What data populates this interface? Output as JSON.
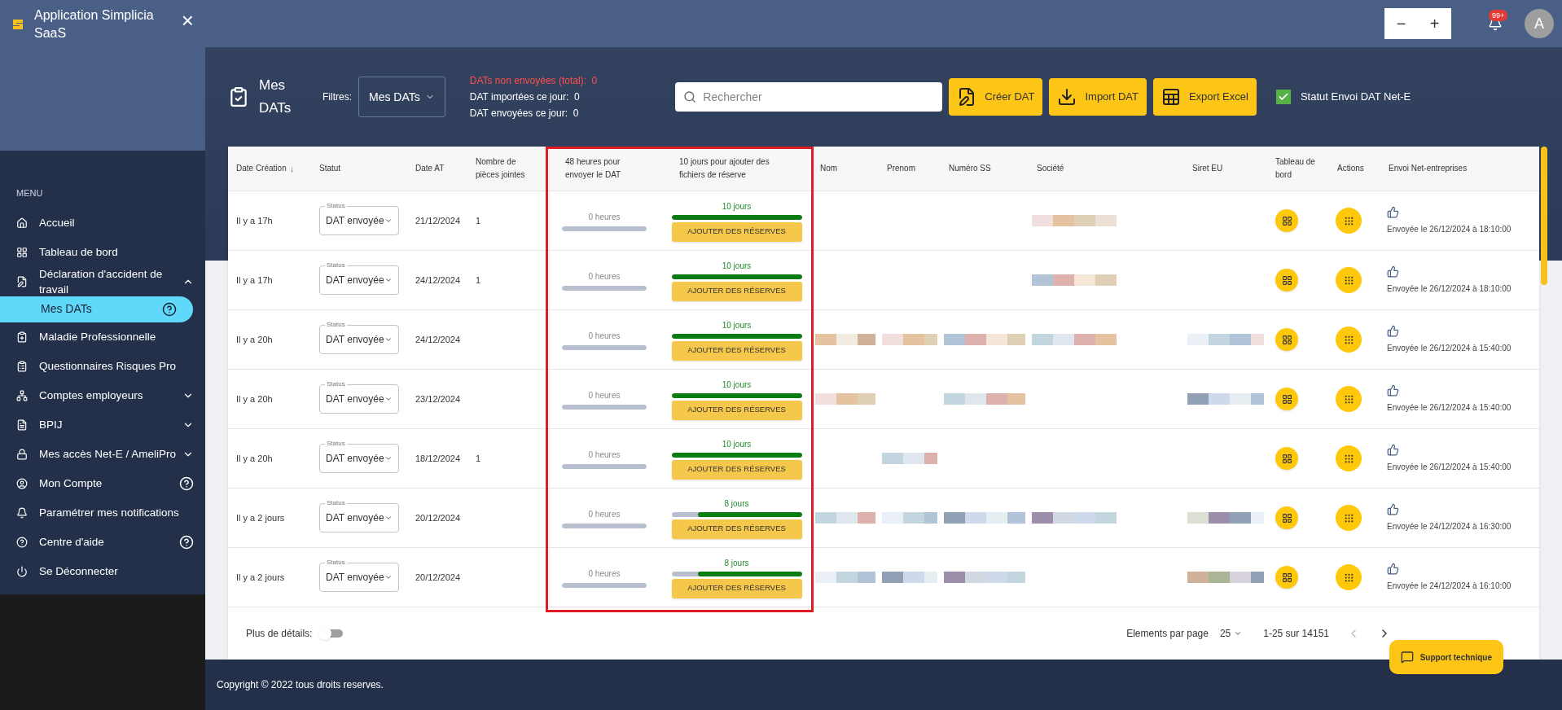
{
  "sidebar": {
    "app_title": "Application Simplicia SaaS",
    "close": "×",
    "menu_title": "MENU",
    "items": [
      {
        "label": "Accueil"
      },
      {
        "label": "Tableau de bord"
      },
      {
        "label": "Déclaration d'accident de travail",
        "expanded": true,
        "children": [
          {
            "label": "Mes DATs",
            "selected": true,
            "help": true
          }
        ]
      },
      {
        "label": "Maladie Professionnelle"
      },
      {
        "label": "Questionnaires Risques Pro"
      },
      {
        "label": "Comptes employeurs",
        "expanded": false
      },
      {
        "label": "BPIJ",
        "expanded": false
      },
      {
        "label": "Mes accès Net-E / AmeliPro",
        "expanded": false
      },
      {
        "label": "Mon Compte",
        "help": true
      },
      {
        "label": "Paramétrer mes notifications"
      },
      {
        "label": "Centre d'aide",
        "help": true
      },
      {
        "label": "Se Déconnecter"
      }
    ]
  },
  "topbar": {
    "zoom_out": "−",
    "zoom_in": "+",
    "notifications": "99+",
    "avatar": "A"
  },
  "page": {
    "title": "Mes DATs",
    "filter_label": "Filtres:",
    "filter_value": "Mes DATs",
    "stats": [
      {
        "text": "DATs non envoyées (total):  0",
        "alert": true
      },
      {
        "text": "DAT importées ce jour:  0",
        "alert": false
      },
      {
        "text": "DAT envoyées ce jour:  0",
        "alert": false
      }
    ],
    "search": {
      "placeholder": "Rechercher"
    },
    "buttons": [
      "Créer DAT",
      "Import DAT",
      "Export Excel"
    ],
    "net_e_status": {
      "label": "Statut Envoi DAT Net-E",
      "checked": true
    }
  },
  "table": {
    "columns": [
      "Date Création",
      "Statut",
      "Date AT",
      "Nombre de pièces jointes",
      "48 heures pour envoyer le DAT",
      "10 jours pour ajouter des fichiers de réserve",
      "Nom",
      "Prenom",
      "Numéro SS",
      "Société",
      "Siret EU",
      "Tableau de bord",
      "Actions",
      "Envoi Net-entreprises"
    ],
    "sort_icon": "↓",
    "rows": [
      {
        "created": "Il y a 17h",
        "status_label": "Status",
        "status": "DAT envoyée",
        "date_at": "21/12/2024",
        "attachments": "1",
        "hours": {
          "text": "0 heures",
          "level": 1
        },
        "days": {
          "text": "10 jours",
          "level": 1
        },
        "reserve_button": "AJOUTER DES RÉSERVES",
        "redacted": [
          false,
          false,
          false,
          true,
          false
        ],
        "sent": "Envoyée le 26/12/2024 à 18:10:00"
      },
      {
        "created": "Il y a 17h",
        "status_label": "Status",
        "status": "DAT envoyée",
        "date_at": "24/12/2024",
        "attachments": "1",
        "hours": {
          "text": "0 heures",
          "level": 1
        },
        "days": {
          "text": "10 jours",
          "level": 1
        },
        "reserve_button": "AJOUTER DES RÉSERVES",
        "redacted": [
          false,
          false,
          false,
          true,
          false
        ],
        "sent": "Envoyée le 26/12/2024 à 18:10:00"
      },
      {
        "created": "Il y a 20h",
        "status_label": "Status",
        "status": "DAT envoyée",
        "date_at": "24/12/2024",
        "hours": {
          "text": "0 heures",
          "level": 1
        },
        "days": {
          "text": "10 jours",
          "level": 1
        },
        "reserve_button": "AJOUTER DES RÉSERVES",
        "redacted": [
          true,
          true,
          true,
          true,
          true
        ],
        "sent": "Envoyée le 26/12/2024 à 15:40:00"
      },
      {
        "created": "Il y a 20h",
        "status_label": "Status",
        "status": "DAT envoyée",
        "date_at": "23/12/2024",
        "hours": {
          "text": "0 heures",
          "level": 1
        },
        "days": {
          "text": "10 jours",
          "level": 1
        },
        "reserve_button": "AJOUTER DES RÉSERVES",
        "redacted": [
          true,
          false,
          true,
          false,
          true
        ],
        "sent": "Envoyée le 26/12/2024 à 15:40:00"
      },
      {
        "created": "Il y a 20h",
        "status_label": "Status",
        "status": "DAT envoyée",
        "date_at": "18/12/2024",
        "attachments": "1",
        "hours": {
          "text": "0 heures",
          "level": 1
        },
        "days": {
          "text": "10 jours",
          "level": 1
        },
        "reserve_button": "AJOUTER DES RÉSERVES",
        "redacted": [
          false,
          true,
          false,
          false,
          false
        ],
        "sent": "Envoyée le 26/12/2024 à 15:40:00"
      },
      {
        "created": "Il y a 2 jours",
        "status_label": "Status",
        "status": "DAT envoyée",
        "date_at": "20/12/2024",
        "hours": {
          "text": "0 heures",
          "level": 1
        },
        "days": {
          "text": "8 jours",
          "level": 0.8
        },
        "reserve_button": "AJOUTER DES RÉSERVES",
        "redacted": [
          true,
          true,
          true,
          true,
          true
        ],
        "sent": "Envoyée le 24/12/2024 à 16:30:00"
      },
      {
        "created": "Il y a 2 jours",
        "status_label": "Status",
        "status": "DAT envoyée",
        "date_at": "20/12/2024",
        "hours": {
          "text": "0 heures",
          "level": 1
        },
        "days": {
          "text": "8 jours",
          "level": 0.8
        },
        "reserve_button": "AJOUTER DES RÉSERVES",
        "redacted": [
          true,
          true,
          true,
          false,
          true
        ],
        "sent": "Envoyée le 24/12/2024 à 16:10:00"
      }
    ],
    "details_label": "Plus de détails:",
    "details_on": false,
    "per_page_label": "Elements par page",
    "per_page": "25",
    "range": "1-25 sur 14151"
  },
  "support_button": "Support technique",
  "footer": "Copyright © 2022 tous droits reserves."
}
